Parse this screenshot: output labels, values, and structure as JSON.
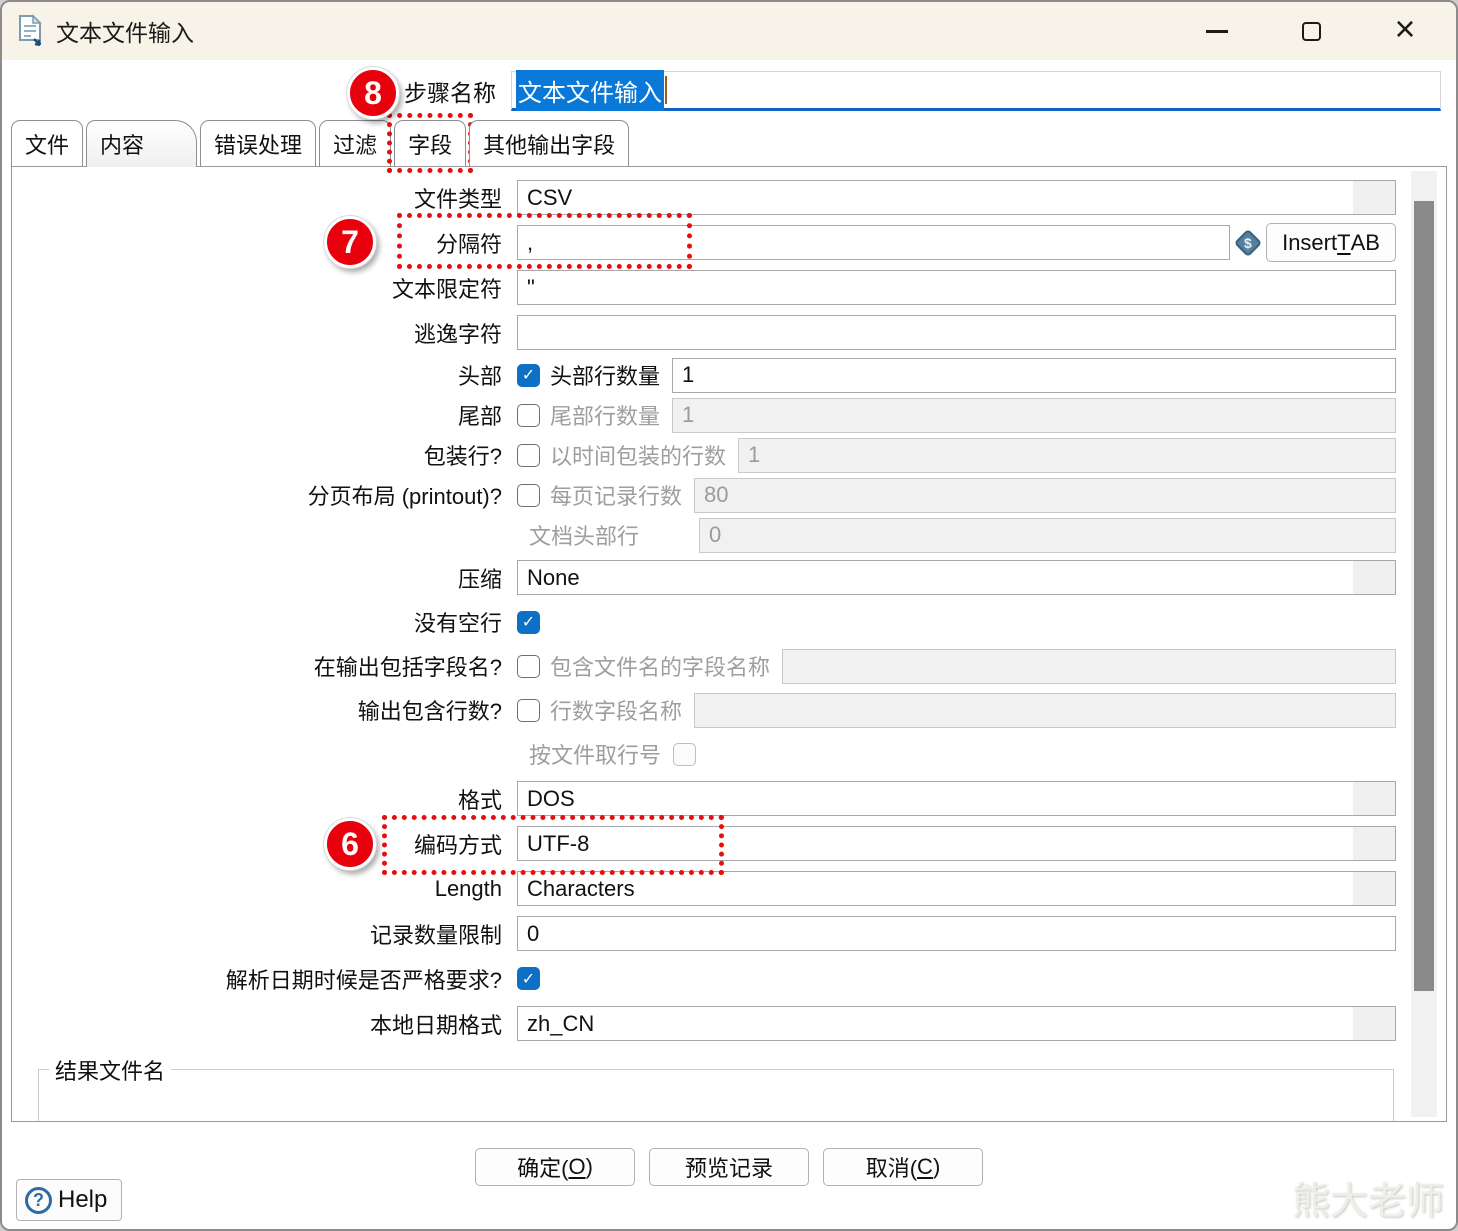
{
  "window": {
    "title": "文本文件输入"
  },
  "step_name": {
    "label": "步骤名称",
    "value": "文本文件输入"
  },
  "annotations": {
    "badge_6": "6",
    "badge_7": "7",
    "badge_8": "8"
  },
  "tabs": {
    "items": [
      {
        "label": "文件"
      },
      {
        "label": "内容"
      },
      {
        "label": "错误处理"
      },
      {
        "label": "过滤"
      },
      {
        "label": "字段"
      },
      {
        "label": "其他输出字段"
      }
    ],
    "active": "内容",
    "highlighted": "字段"
  },
  "form": {
    "file_type": {
      "label": "文件类型",
      "value": "CSV"
    },
    "separator": {
      "label": "分隔符",
      "value": ","
    },
    "variable_icon": "$",
    "insert_tab": {
      "pre": "Insert ",
      "key": "T",
      "post": "AB"
    },
    "enclosure": {
      "label": "文本限定符",
      "value": "\""
    },
    "escape": {
      "label": "逃逸字符",
      "value": ""
    },
    "header": {
      "label": "头部",
      "checked": true,
      "sub_label": "头部行数量",
      "value": "1"
    },
    "footer": {
      "label": "尾部",
      "checked": false,
      "sub_label": "尾部行数量",
      "value": "1"
    },
    "wrapped": {
      "label": "包装行?",
      "checked": false,
      "sub_label": "以时间包装的行数",
      "value": "1"
    },
    "paged": {
      "label": "分页布局 (printout)?",
      "checked": false,
      "sub_label": "每页记录行数",
      "value": "80"
    },
    "doc_header": {
      "label": "文档头部行",
      "value": "0"
    },
    "compression": {
      "label": "压缩",
      "value": "None"
    },
    "no_empty_rows": {
      "label": "没有空行",
      "checked": true
    },
    "include_filename": {
      "label": "在输出包括字段名?",
      "checked": false,
      "sub_label": "包含文件名的字段名称",
      "value": ""
    },
    "include_rownum": {
      "label": "输出包含行数?",
      "checked": false,
      "sub_label": "行数字段名称",
      "value": ""
    },
    "rownum_by_file": {
      "label": "按文件取行号",
      "checked": false
    },
    "format": {
      "label": "格式",
      "value": "DOS"
    },
    "encoding": {
      "label": "编码方式",
      "value": "UTF-8"
    },
    "length": {
      "label": "Length",
      "value": "Characters"
    },
    "row_limit": {
      "label": "记录数量限制",
      "value": "0"
    },
    "strict_dates": {
      "label": "解析日期时候是否严格要求?",
      "checked": true
    },
    "date_locale": {
      "label": "本地日期格式",
      "value": "zh_CN"
    }
  },
  "result_group": {
    "label": "结果文件名"
  },
  "buttons": {
    "ok": {
      "pre": "确定(",
      "key": "O",
      "post": ")"
    },
    "preview": "预览记录",
    "cancel": {
      "pre": "取消(",
      "key": "C",
      "post": ")"
    },
    "help": "Help"
  },
  "watermark": "熊大老师"
}
